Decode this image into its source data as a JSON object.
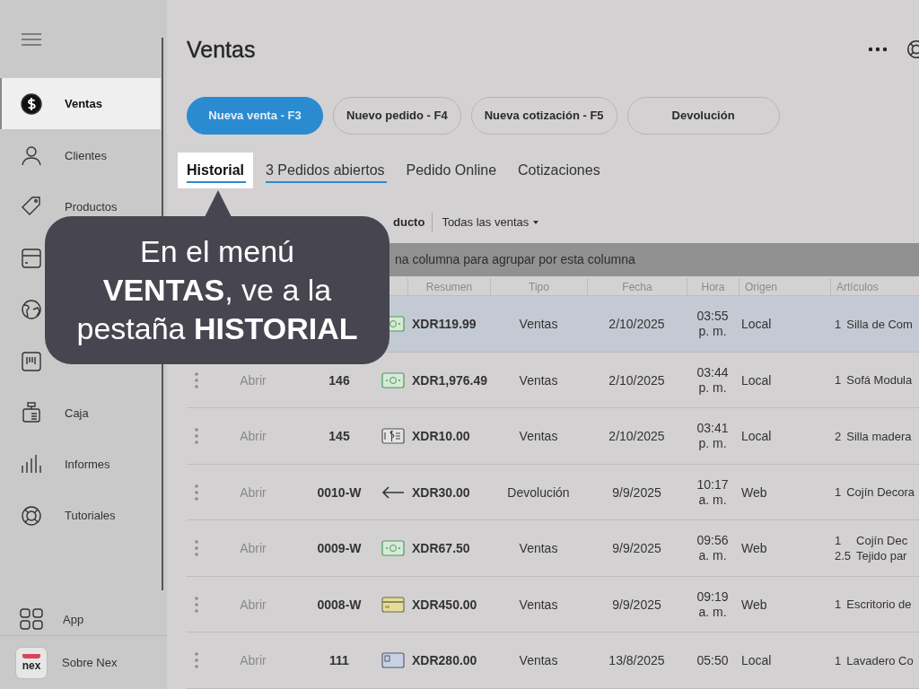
{
  "sidebar": {
    "items": [
      {
        "label": "Ventas",
        "selected": true
      },
      {
        "label": "Clientes",
        "selected": false
      },
      {
        "label": "Productos",
        "selected": false
      },
      {
        "selected": false
      },
      {
        "selected": false
      },
      {
        "selected": false
      },
      {
        "label": "Caja",
        "selected": false
      },
      {
        "label": "Informes",
        "selected": false
      },
      {
        "label": "Tutoriales",
        "selected": false
      }
    ],
    "footer": [
      {
        "label": "App"
      },
      {
        "label": "Sobre Nex",
        "logo_text": "nex"
      }
    ]
  },
  "page": {
    "title": "Ventas"
  },
  "actions": [
    {
      "label": "Nueva venta - F3",
      "primary": true
    },
    {
      "label": "Nuevo pedido - F4",
      "primary": false
    },
    {
      "label": "Nueva cotización - F5",
      "primary": false
    },
    {
      "label": "Devolución",
      "primary": false
    }
  ],
  "tabs": [
    {
      "label": "Historial",
      "selected": true,
      "underlined": true
    },
    {
      "label": "3 Pedidos abiertos",
      "selected": false,
      "underlined": true
    },
    {
      "label": "Pedido Online",
      "selected": false,
      "underlined": false
    },
    {
      "label": "Cotizaciones",
      "selected": false,
      "underlined": false
    }
  ],
  "filters": {
    "field": "ducto",
    "dropdown": "Todas las ventas"
  },
  "group_hint": "na columna para agrupar por esta columna",
  "table": {
    "columns": [
      "Resumen",
      "Tipo",
      "Fecha",
      "Hora",
      "Origen",
      "Artículos"
    ],
    "rows": [
      {
        "selected": true,
        "kind": "cash",
        "total": "XDR119.99",
        "type": "Ventas",
        "date": "2/10/2025",
        "time": "03:55\np. m.",
        "origin": "Local",
        "articles": [
          {
            "qty": "1",
            "name": "Silla de Com"
          }
        ]
      },
      {
        "selected": false,
        "action": "Abrir",
        "number": "146",
        "kind": "cash",
        "total": "XDR1,976.49",
        "type": "Ventas",
        "date": "2/10/2025",
        "time": "03:44\np. m.",
        "origin": "Local",
        "articles": [
          {
            "qty": "1",
            "name": "Sofá Modula"
          }
        ]
      },
      {
        "selected": false,
        "action": "Abrir",
        "number": "145",
        "kind": "voucher",
        "total": "XDR10.00",
        "type": "Ventas",
        "date": "2/10/2025",
        "time": "03:41\np. m.",
        "origin": "Local",
        "articles": [
          {
            "qty": "2",
            "name": "Silla madera"
          }
        ]
      },
      {
        "selected": false,
        "action": "Abrir",
        "number": "0010-W",
        "kind": "return",
        "total": "XDR30.00",
        "type": "Devolución",
        "date": "9/9/2025",
        "time": "10:17\na. m.",
        "origin": "Web",
        "articles": [
          {
            "qty": "1",
            "name": "Cojín Decora"
          }
        ]
      },
      {
        "selected": false,
        "action": "Abrir",
        "number": "0009-W",
        "kind": "cash",
        "total": "XDR67.50",
        "type": "Ventas",
        "date": "9/9/2025",
        "time": "09:56\na. m.",
        "origin": "Web",
        "articles": [
          {
            "qty": "1",
            "name": "Cojín Dec"
          },
          {
            "qty": "2.5",
            "name": "Tejido par"
          }
        ]
      },
      {
        "selected": false,
        "action": "Abrir",
        "number": "0008-W",
        "kind": "card",
        "total": "XDR450.00",
        "type": "Ventas",
        "date": "9/9/2025",
        "time": "09:19\na. m.",
        "origin": "Web",
        "articles": [
          {
            "qty": "1",
            "name": "Escritorio de"
          }
        ]
      },
      {
        "selected": false,
        "action": "Abrir",
        "number": "111",
        "kind": "id-card",
        "total": "XDR280.00",
        "type": "Ventas",
        "date": "13/8/2025",
        "time": "05:50",
        "origin": "Local",
        "articles": [
          {
            "qty": "1",
            "name": "Lavadero Co"
          }
        ]
      }
    ]
  },
  "callout": {
    "lines": [
      "En el menú",
      "**VENTAS**, ve a la",
      "pestaña **HISTORIAL**"
    ]
  }
}
